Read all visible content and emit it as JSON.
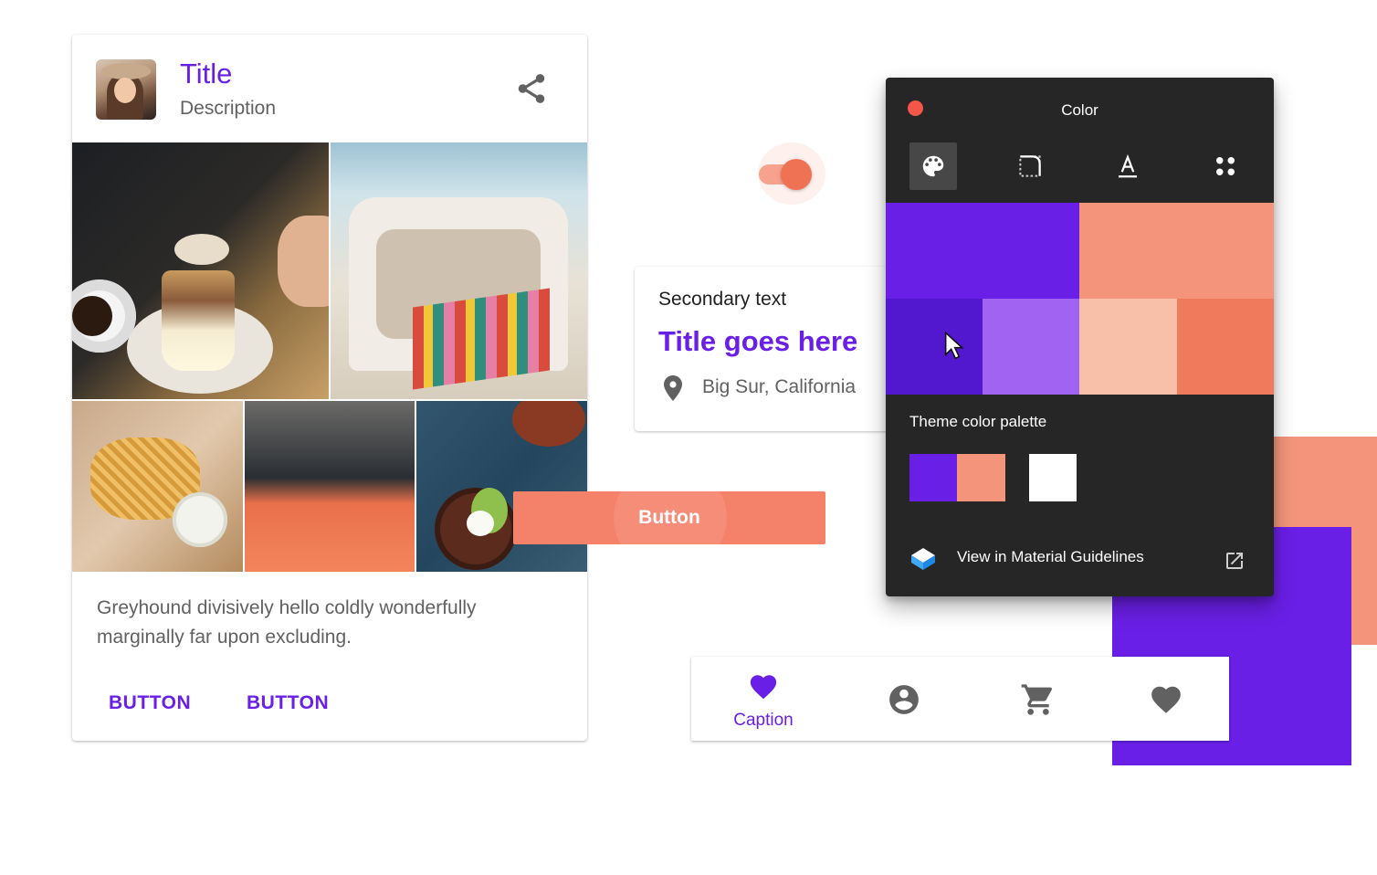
{
  "card": {
    "title": "Title",
    "description": "Description",
    "body": "Greyhound divisively hello coldly wonderfully marginally far upon excluding.",
    "buttons": [
      "BUTTON",
      "BUTTON"
    ]
  },
  "list_card": {
    "secondary_text": "Secondary text",
    "title": "Title goes here",
    "location": "Big Sur, California"
  },
  "switch": {
    "state": "on"
  },
  "button": {
    "label": "Button"
  },
  "bottom_nav": {
    "items": [
      {
        "icon": "heart-icon",
        "caption": "Caption",
        "active": true
      },
      {
        "icon": "account-circle-icon",
        "active": false
      },
      {
        "icon": "shopping-cart-icon",
        "active": false
      },
      {
        "icon": "heart-icon",
        "active": false
      }
    ]
  },
  "color_panel": {
    "title": "Color",
    "tools": [
      "palette-icon",
      "shape-icon",
      "typography-icon",
      "components-icon"
    ],
    "primary_swatches": [
      "#6A1FE6",
      "#F4957B"
    ],
    "secondary_swatches": [
      "#5118D0",
      "#A063F2",
      "#F8BFA9",
      "#F07A5C"
    ],
    "theme_palette_label": "Theme color palette",
    "theme_palette": [
      "#6A1FE6",
      "#F4957B",
      "#FFFFFF"
    ],
    "guidelines_link": "View in Material Guidelines"
  },
  "colors": {
    "primary": "#6A1FE6",
    "secondary": "#F4816A",
    "panel_bg": "#262626",
    "close_dot": "#F4564A"
  }
}
